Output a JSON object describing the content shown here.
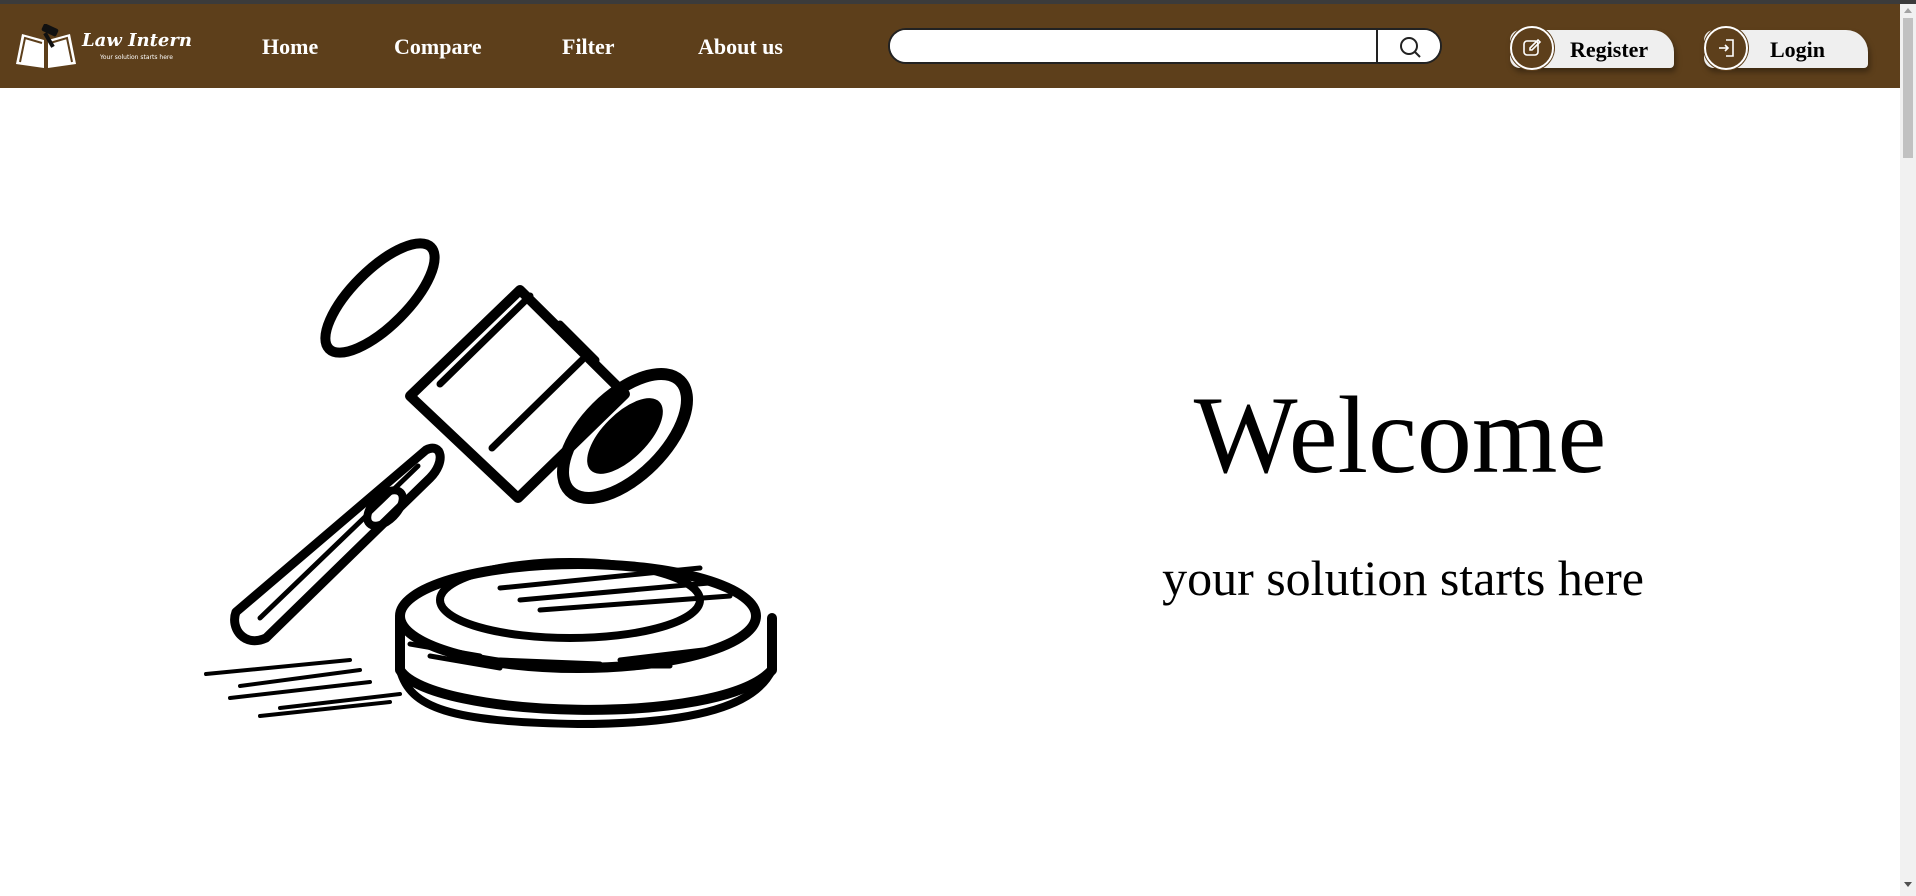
{
  "colors": {
    "navbar_bg": "#5d3f1b",
    "nav_text": "#ffffff",
    "button_bg": "#efefef"
  },
  "brand": {
    "name": "Law Intern",
    "tagline": "Your solution starts here",
    "logo_icon": "book-gavel-logo"
  },
  "nav": {
    "links": [
      {
        "label": "Home"
      },
      {
        "label": "Compare"
      },
      {
        "label": "Filter"
      },
      {
        "label": "About us"
      }
    ]
  },
  "search": {
    "value": "",
    "placeholder": "",
    "icon": "search-icon"
  },
  "auth": {
    "register": {
      "label": "Register",
      "icon": "edit-icon"
    },
    "login": {
      "label": "Login",
      "icon": "login-icon"
    }
  },
  "hero": {
    "title": "Welcome",
    "subtitle": "your solution starts here",
    "image": "gavel-illustration"
  }
}
